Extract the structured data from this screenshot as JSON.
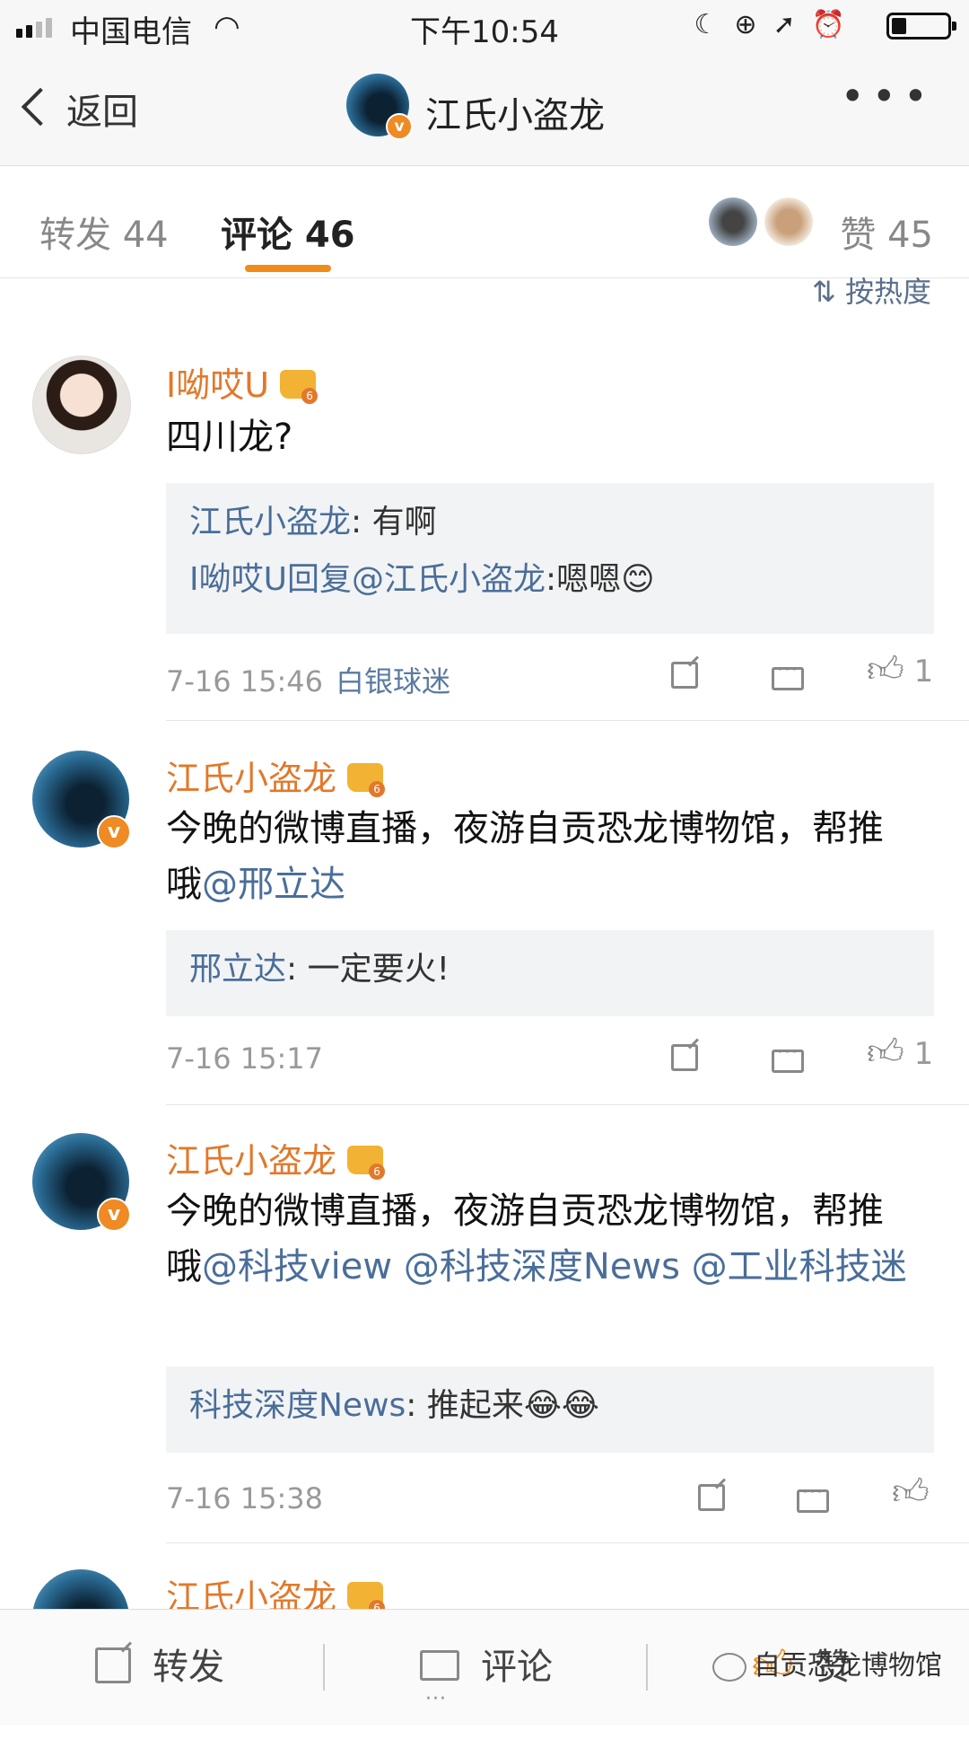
{
  "status_bar": {
    "carrier": "中国电信",
    "time": "下午10:54"
  },
  "nav": {
    "back_label": "返回",
    "title": "江氏小盗龙"
  },
  "tabs": {
    "repost_label": "转发 44",
    "comment_label": "评论 46",
    "likes_label": "赞 45"
  },
  "sort_label": "⇅ 按热度",
  "comments": [
    {
      "user": "I呦哎U",
      "text": "四川龙?",
      "replies": [
        {
          "name": "江氏小盗龙",
          "text": ": 有啊"
        },
        {
          "name": "I呦哎U回复@江氏小盗龙",
          "text": ":嗯嗯😊"
        }
      ],
      "time": "7-16 15:46",
      "source": "白银球迷",
      "like_count": "1"
    },
    {
      "user": "江氏小盗龙",
      "text_plain": "今晚的微博直播，夜游自贡恐龙博物馆，帮推哦",
      "mentions": "@邢立达",
      "replies": [
        {
          "name": "邢立达",
          "text": ": 一定要火!"
        }
      ],
      "time": "7-16 15:17",
      "like_count": "1"
    },
    {
      "user": "江氏小盗龙",
      "text_plain": "今晚的微博直播，夜游自贡恐龙博物馆，帮推哦",
      "mentions": "@科技view @科技深度News @工业科技迷",
      "replies": [
        {
          "name": "科技深度News",
          "text": ": 推起来😂😂"
        }
      ],
      "time": "7-16 15:38",
      "like_count": ""
    },
    {
      "user": "江氏小盗龙"
    }
  ],
  "toolbar": {
    "repost_label": "转发",
    "comment_label": "评论",
    "like_label": "赞"
  },
  "watermark": "自贡恐龙博物馆",
  "colors": {
    "accent_orange": "#f08c1a",
    "username_orange": "#e2782a",
    "link_blue": "#4a6e9a"
  }
}
